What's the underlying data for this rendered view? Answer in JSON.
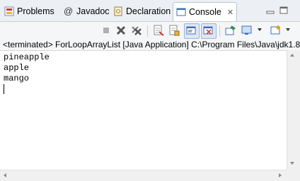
{
  "tabs": [
    {
      "label": "Problems",
      "icon": "problems-icon"
    },
    {
      "label": "Javadoc",
      "icon": "javadoc-icon"
    },
    {
      "label": "Declaration",
      "icon": "declaration-icon"
    },
    {
      "label": "Console",
      "icon": "console-icon",
      "active": true
    }
  ],
  "status_line": "<terminated> ForLoopArrayList [Java Application] C:\\Program Files\\Java\\jdk1.8",
  "console_lines": [
    "pineapple",
    "apple",
    "mango"
  ],
  "colors": {
    "accent": "#3a6fbf",
    "error": "#d0342c"
  }
}
